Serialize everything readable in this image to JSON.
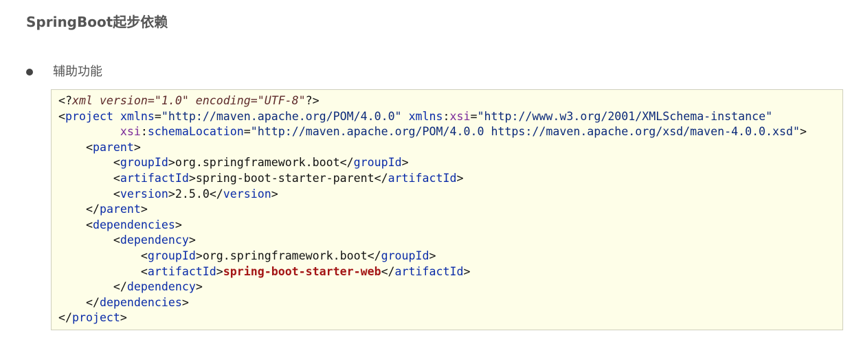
{
  "page": {
    "title": "SpringBoot起步依赖"
  },
  "bullet": {
    "text": "辅助功能"
  },
  "code": {
    "language": "xml",
    "lines": [
      [
        {
          "t": "<?",
          "c": "punc"
        },
        {
          "t": "xml version=\"1.0\" encoding=\"UTF-8\"",
          "c": "pi-body"
        },
        {
          "t": "?>",
          "c": "punc"
        }
      ],
      [
        {
          "t": "<",
          "c": "punc"
        },
        {
          "t": "project",
          "c": "tag"
        },
        {
          "t": " ",
          "c": "text"
        },
        {
          "t": "xmlns",
          "c": "attr"
        },
        {
          "t": "=",
          "c": "punc"
        },
        {
          "t": "\"http://maven.apache.org/POM/4.0.0\"",
          "c": "str"
        },
        {
          "t": " ",
          "c": "text"
        },
        {
          "t": "xmlns",
          "c": "attr"
        },
        {
          "t": ":",
          "c": "punc"
        },
        {
          "t": "xsi",
          "c": "ns"
        },
        {
          "t": "=",
          "c": "punc"
        },
        {
          "t": "\"http://www.w3.org/2001/XMLSchema-instance\"",
          "c": "str"
        }
      ],
      [
        {
          "t": "         ",
          "c": "text"
        },
        {
          "t": "xsi",
          "c": "ns"
        },
        {
          "t": ":",
          "c": "punc"
        },
        {
          "t": "schemaLocation",
          "c": "attr"
        },
        {
          "t": "=",
          "c": "punc"
        },
        {
          "t": "\"http://maven.apache.org/POM/4.0.0 https://maven.apache.org/xsd/maven-4.0.0.xsd\"",
          "c": "str"
        },
        {
          "t": ">",
          "c": "punc"
        }
      ],
      [
        {
          "t": "    <",
          "c": "punc"
        },
        {
          "t": "parent",
          "c": "tag"
        },
        {
          "t": ">",
          "c": "punc"
        }
      ],
      [
        {
          "t": "        <",
          "c": "punc"
        },
        {
          "t": "groupId",
          "c": "tag"
        },
        {
          "t": ">",
          "c": "punc"
        },
        {
          "t": "org.springframework.boot",
          "c": "text"
        },
        {
          "t": "</",
          "c": "punc"
        },
        {
          "t": "groupId",
          "c": "tag"
        },
        {
          "t": ">",
          "c": "punc"
        }
      ],
      [
        {
          "t": "        <",
          "c": "punc"
        },
        {
          "t": "artifactId",
          "c": "tag"
        },
        {
          "t": ">",
          "c": "punc"
        },
        {
          "t": "spring-boot-starter-parent",
          "c": "text"
        },
        {
          "t": "</",
          "c": "punc"
        },
        {
          "t": "artifactId",
          "c": "tag"
        },
        {
          "t": ">",
          "c": "punc"
        }
      ],
      [
        {
          "t": "        <",
          "c": "punc"
        },
        {
          "t": "version",
          "c": "tag"
        },
        {
          "t": ">",
          "c": "punc"
        },
        {
          "t": "2.5.0",
          "c": "text"
        },
        {
          "t": "</",
          "c": "punc"
        },
        {
          "t": "version",
          "c": "tag"
        },
        {
          "t": ">",
          "c": "punc"
        }
      ],
      [
        {
          "t": "    </",
          "c": "punc"
        },
        {
          "t": "parent",
          "c": "tag"
        },
        {
          "t": ">",
          "c": "punc"
        }
      ],
      [
        {
          "t": "    <",
          "c": "punc"
        },
        {
          "t": "dependencies",
          "c": "tag"
        },
        {
          "t": ">",
          "c": "punc"
        }
      ],
      [
        {
          "t": "        <",
          "c": "punc"
        },
        {
          "t": "dependency",
          "c": "tag"
        },
        {
          "t": ">",
          "c": "punc"
        }
      ],
      [
        {
          "t": "            <",
          "c": "punc"
        },
        {
          "t": "groupId",
          "c": "tag"
        },
        {
          "t": ">",
          "c": "punc"
        },
        {
          "t": "org.springframework.boot",
          "c": "text"
        },
        {
          "t": "</",
          "c": "punc"
        },
        {
          "t": "groupId",
          "c": "tag"
        },
        {
          "t": ">",
          "c": "punc"
        }
      ],
      [
        {
          "t": "            <",
          "c": "punc"
        },
        {
          "t": "artifactId",
          "c": "tag"
        },
        {
          "t": ">",
          "c": "punc"
        },
        {
          "t": "spring-boot-starter-web",
          "c": "hl"
        },
        {
          "t": "</",
          "c": "punc"
        },
        {
          "t": "artifactId",
          "c": "tag"
        },
        {
          "t": ">",
          "c": "punc"
        }
      ],
      [
        {
          "t": "        </",
          "c": "punc"
        },
        {
          "t": "dependency",
          "c": "tag"
        },
        {
          "t": ">",
          "c": "punc"
        }
      ],
      [
        {
          "t": "    </",
          "c": "punc"
        },
        {
          "t": "dependencies",
          "c": "tag"
        },
        {
          "t": ">",
          "c": "punc"
        }
      ],
      [
        {
          "t": "</",
          "c": "punc"
        },
        {
          "t": "project",
          "c": "tag"
        },
        {
          "t": ">",
          "c": "punc"
        }
      ]
    ]
  },
  "colors": {
    "code_background": "#fefee8",
    "code_border": "#cfcfbc",
    "tag": "#0a2ba8",
    "namespace_prefix": "#7a2a9a",
    "string": "#0c2a7a",
    "highlight": "#a31515",
    "title_text": "#555555"
  }
}
